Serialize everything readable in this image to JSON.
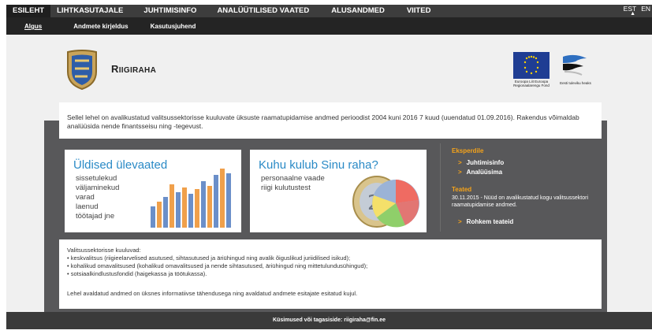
{
  "topnav": {
    "items": [
      "ESILEHT",
      "LIHTKASUTAJALE",
      "JUHTIMISINFO",
      "ANALÜÜTILISED VAATED",
      "ALUSANDMED",
      "VIITED"
    ],
    "lang": [
      "EST",
      "EN"
    ]
  },
  "subnav": {
    "items": [
      "Algus",
      "Andmete kirjeldus",
      "Kasutusjuhend"
    ]
  },
  "header": {
    "title_initial": "R",
    "title_rest": "IIGIRAHA",
    "eu_logo_text": "Euroopa Liit Euroopa Regionaalarengu Fond",
    "ee_logo_text": "Eesti tuleviku heaks"
  },
  "intro": {
    "text": "Sellel lehel on avalikustatud valitsussektorisse kuuluvate üksuste raamatupidamise andmed perioodist 2004 kuni 2016 7 kuud (uuendatud 01.09.2016). Rakendus võimaldab analüüsida nende finantsseisu ning -tegevust."
  },
  "card1": {
    "title": "Üldised ülevaated",
    "items": [
      "sissetulekud",
      "väljaminekud",
      "varad",
      "laenud",
      "töötajad jne"
    ]
  },
  "card2": {
    "title": "Kuhu kulub Sinu raha?",
    "lines": [
      "personaalne vaade",
      "riigi kulutustest"
    ]
  },
  "sidebar": {
    "experts_heading": "Eksperdile",
    "expert_links": [
      "Juhtimisinfo",
      "Analüüsima"
    ],
    "news_heading": "Teated",
    "news_text": "30.11.2015 - Nüüd on avalikustatud kogu valitsussektori raamatupidamise andmed.",
    "more_news": "Rohkem teateid"
  },
  "notice": {
    "heading": "Valitsussektorisse kuuluvad:",
    "bullets": [
      "keskvalitsus (riigieelarvelised asutused, sihtasutused ja äriühingud ning avalik õiguslikud juriidilised isikud);",
      "kohalikud omavalitsused (kohalikud omavalitsused ja nende sihtasutused, äriühingud ning mittetulundusühingud);",
      "sotsiaalkindlustusfondid (haigekassa ja töötukassa)."
    ],
    "footer_text": "Lehel avaldatud andmed on üksnes informatiivse tähendusega ning avaldatud andmete esitajate esitatud kujul."
  },
  "footer": {
    "text": "Küsimused või tagasiside: riigiraha@fin.ee"
  },
  "colors": {
    "accent_blue": "#2a8ac6",
    "accent_orange": "#f5a31a",
    "bar_blue": "#6b8fc9",
    "bar_orange": "#f0a04b",
    "dark_band": "#58585a"
  }
}
